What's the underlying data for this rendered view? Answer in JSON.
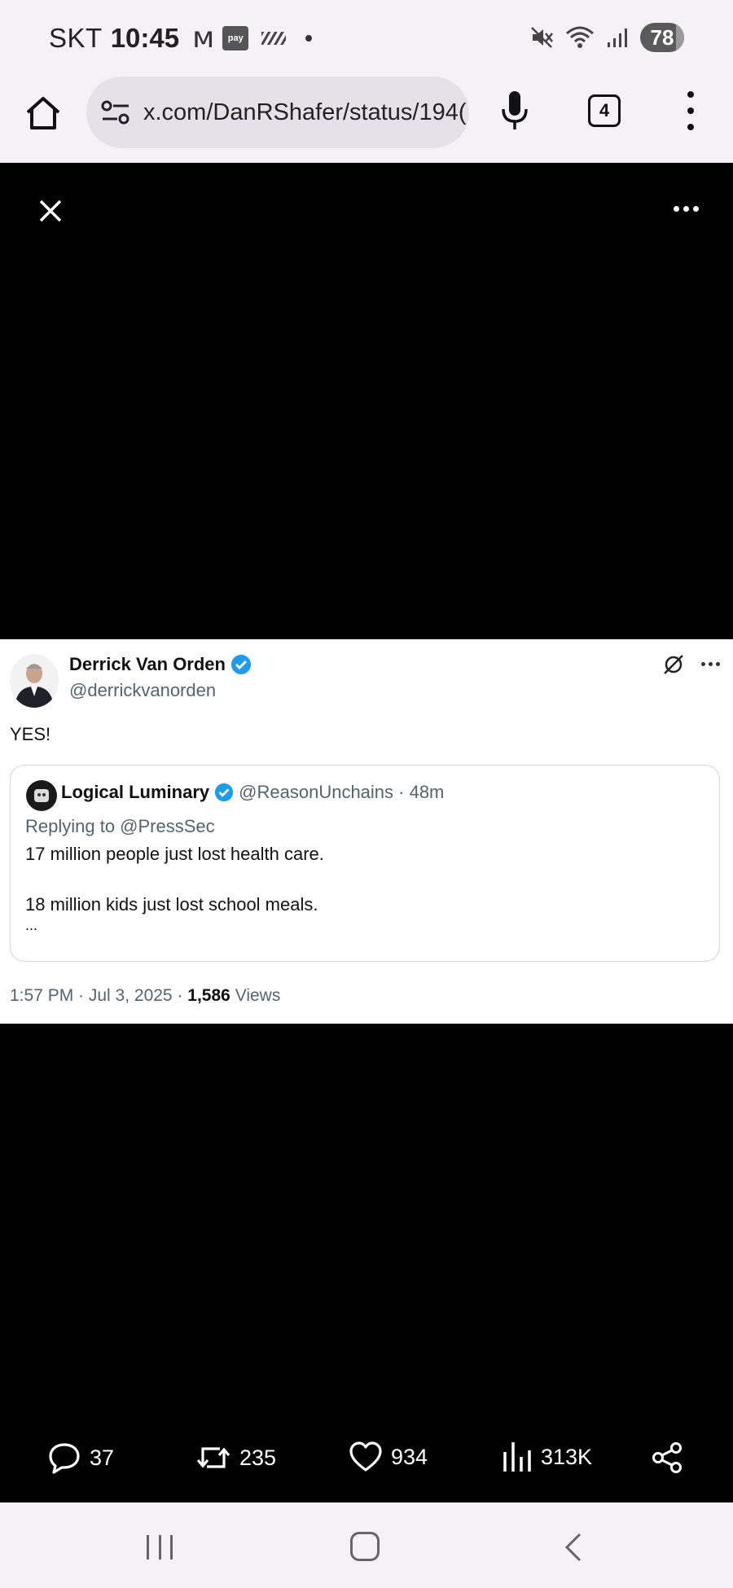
{
  "status_bar": {
    "carrier": "SKT",
    "time": "10:45",
    "pay_label": "pay",
    "battery": "78"
  },
  "browser": {
    "url": "x.com/DanRShafer/status/194(",
    "tab_count": "4"
  },
  "tweet": {
    "author_name": "Derrick Van Orden",
    "author_handle": "@derrickvanorden",
    "text": "YES!",
    "quoted": {
      "name": "Logical Luminary",
      "handle_time": "@ReasonUnchains · 48m",
      "replying_to": "Replying to @PressSec",
      "line1": "17 million people just lost health care.",
      "line2": "18 million kids just lost school meals.",
      "ellipsis": "..."
    },
    "timestamp": "1:57 PM · Jul 3, 2025 ·",
    "views_count": "1,586",
    "views_label": "Views"
  },
  "actions": {
    "replies": "37",
    "reposts": "235",
    "likes": "934",
    "views": "313K"
  }
}
